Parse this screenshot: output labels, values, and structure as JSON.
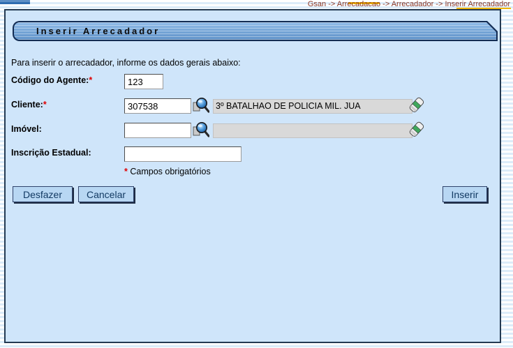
{
  "breadcrumb": {
    "path": "Gsan -> Arrecadacao -> Arrecadador -> Inserir Arrecadador"
  },
  "titlebar": {
    "title": "Inserir Arrecadador"
  },
  "form": {
    "instruction": "Para inserir o arrecadador, informe os dados gerais abaixo:",
    "required_marker": "*",
    "required_note": "Campos obrigatórios",
    "fields": {
      "codigo_agente": {
        "label": "Código do Agente:",
        "value": "123"
      },
      "cliente": {
        "label": "Cliente:",
        "value": "307538",
        "display": "3º BATALHAO DE POLICIA MIL. JUA"
      },
      "imovel": {
        "label": "Imóvel:",
        "value": "",
        "display": ""
      },
      "inscricao_estadual": {
        "label": "Inscrição Estadual:",
        "value": ""
      }
    }
  },
  "buttons": {
    "desfazer": "Desfazer",
    "cancelar": "Cancelar",
    "inserir": "Inserir"
  },
  "icons": {
    "search": "search-icon",
    "erase": "eraser-icon"
  },
  "colors": {
    "panel_bg": "#cfe5fa",
    "panel_border": "#243a52",
    "titlebar_fill": "#7aabdc",
    "button_bg": "#b8d7f3",
    "breadcrumb_text": "#8a3726",
    "highlight_yellow": "#f0b400",
    "required_red": "#e00000",
    "readonly_bg": "#d9d9d9"
  }
}
